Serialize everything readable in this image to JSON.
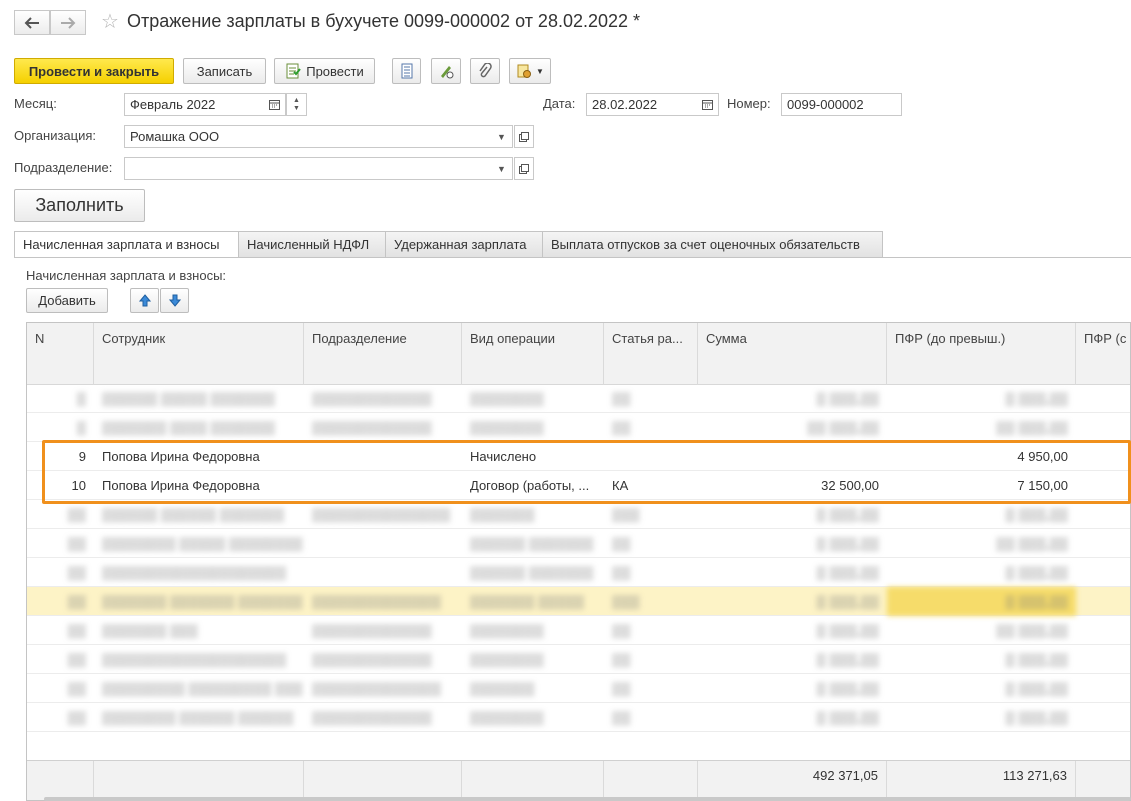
{
  "window": {
    "title": "Отражение зарплаты в бухучете 0099-000002 от 28.02.2022 *"
  },
  "toolbar": {
    "post_close_label": "Провести и закрыть",
    "save_label": "Записать",
    "post_label": "Провести"
  },
  "form": {
    "month_label": "Месяц:",
    "month_value": "Февраль 2022",
    "date_label": "Дата:",
    "date_value": "28.02.2022",
    "number_label": "Номер:",
    "number_value": "0099-000002",
    "org_label": "Организация:",
    "org_value": "Ромашка ООО",
    "dept_label": "Подразделение:",
    "dept_value": "",
    "fill_button": "Заполнить"
  },
  "tabs": [
    {
      "label": "Начисленная зарплата и взносы"
    },
    {
      "label": "Начисленный НДФЛ"
    },
    {
      "label": "Удержанная зарплата"
    },
    {
      "label": "Выплата отпусков за счет оценочных обязательств"
    }
  ],
  "section": {
    "title": "Начисленная зарплата и взносы:",
    "add_button": "Добавить"
  },
  "table": {
    "columns": [
      "N",
      "Сотрудник",
      "Подразделение",
      "Вид операции",
      "Статья ра...",
      "Сумма",
      "ПФР (до превыш.)",
      "ПФР (с"
    ],
    "rows": [
      {
        "n": "9",
        "employee": "Попова Ирина Федоровна",
        "dept": "",
        "operation": "Начислено",
        "article": "",
        "sum": "",
        "pfr": "4 950,00"
      },
      {
        "n": "10",
        "employee": "Попова Ирина Федоровна",
        "dept": "",
        "operation": "Договор (работы, ...",
        "article": "КА",
        "sum": "32 500,00",
        "pfr": "7 150,00"
      }
    ],
    "totals": {
      "sum": "492 371,05",
      "pfr": "113 271,63"
    }
  },
  "colors": {
    "primary_button": "#f5d000",
    "highlight_border": "#f0901c",
    "selected_row": "#fdf3c6"
  }
}
